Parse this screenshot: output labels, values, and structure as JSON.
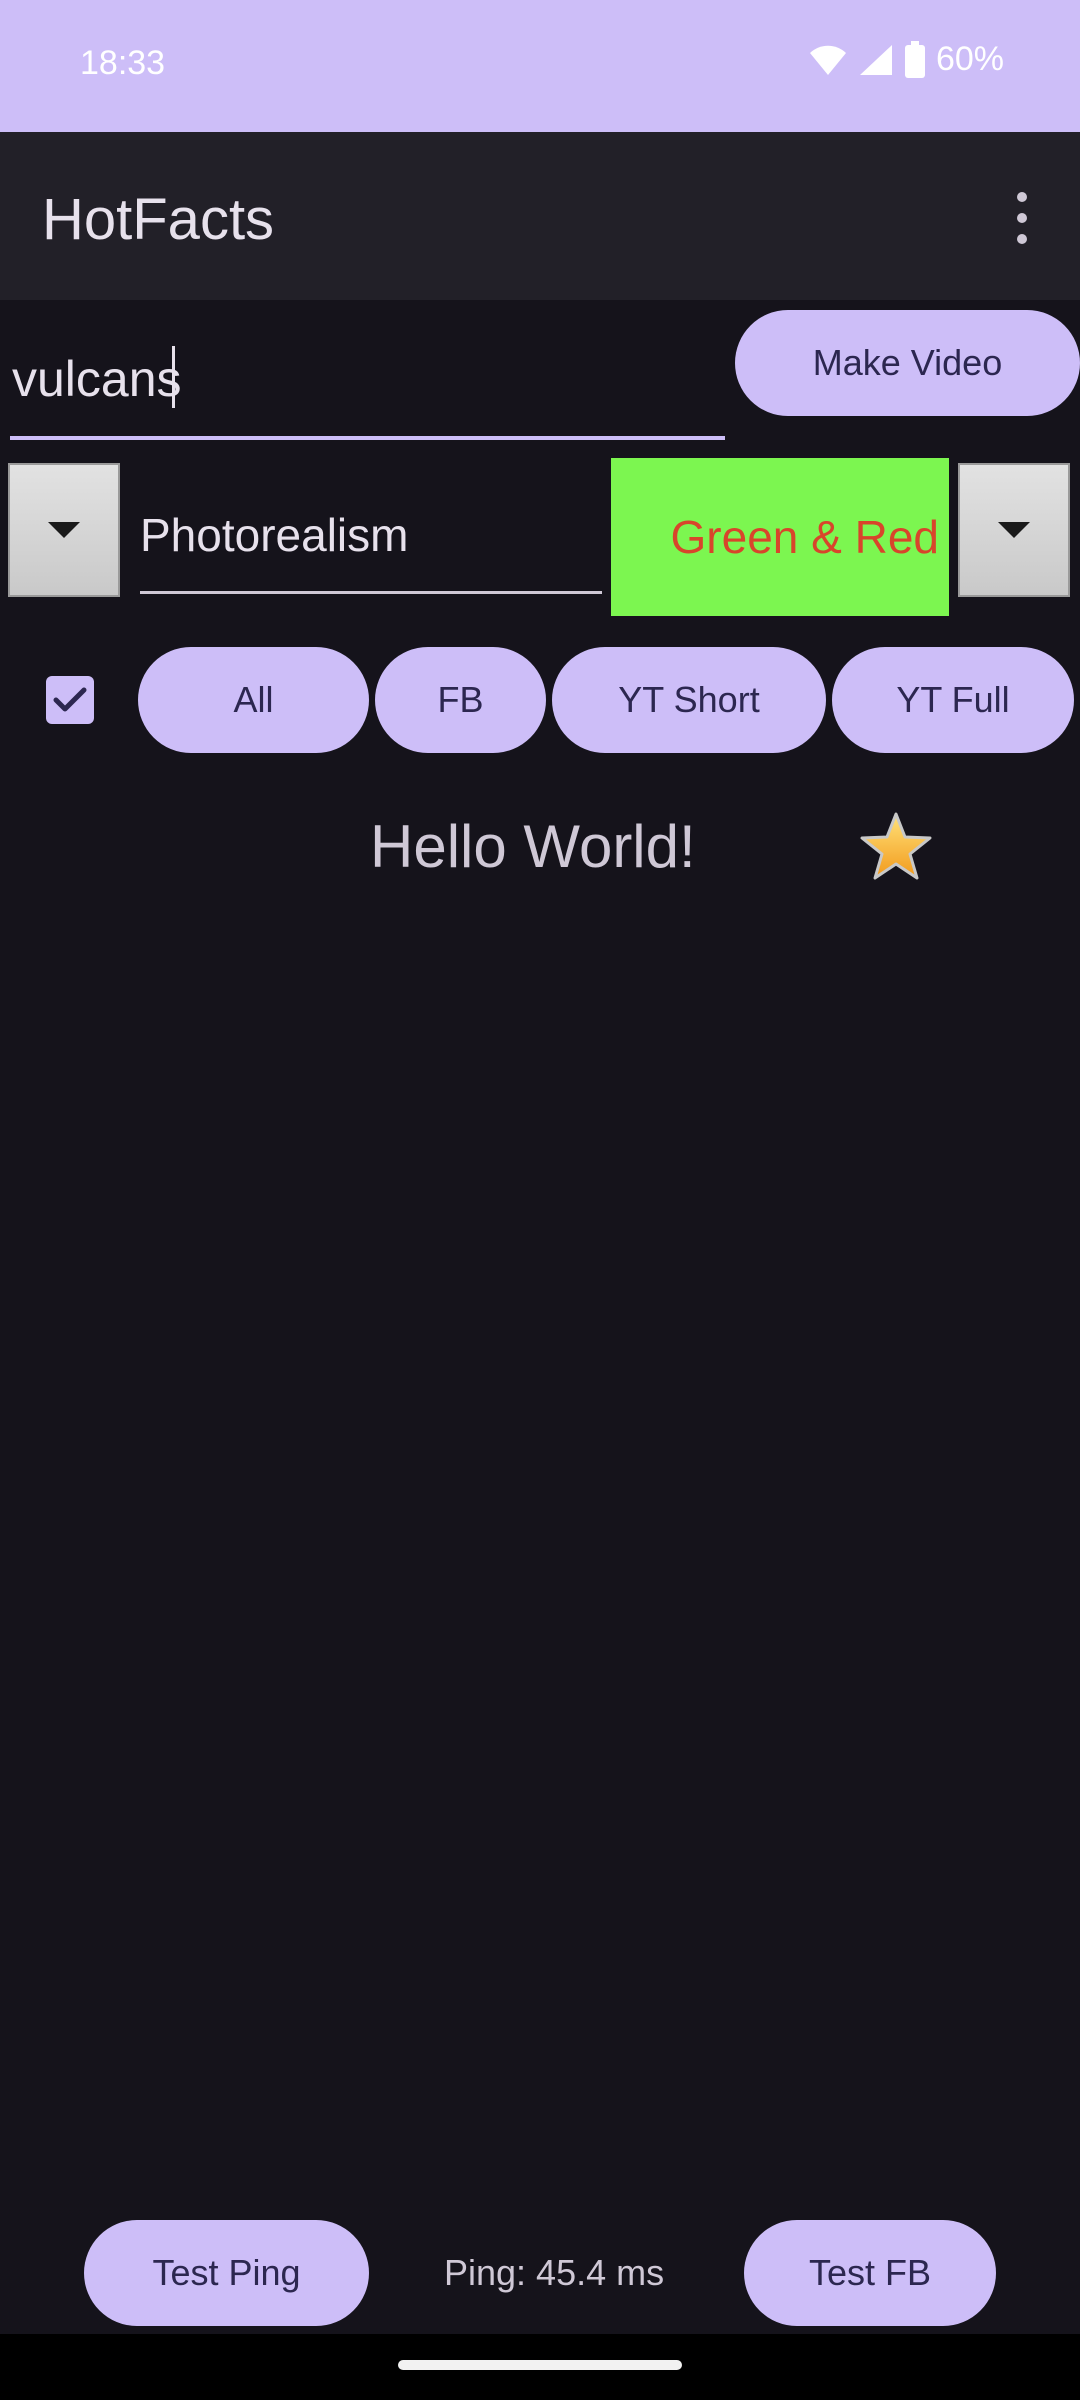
{
  "status": {
    "time": "18:33",
    "battery": "60%"
  },
  "app": {
    "title": "HotFacts"
  },
  "search": {
    "value": "vulcans"
  },
  "buttons": {
    "make_video": "Make Video",
    "all": "All",
    "fb": "FB",
    "yt_short": "YT Short",
    "yt_full": "YT Full",
    "test_ping": "Test Ping",
    "test_fb": "Test FB"
  },
  "style_select": {
    "value": "Photorealism"
  },
  "color_select": {
    "value": "Green & Red",
    "background": "#7cf650",
    "text_color": "#d8452b"
  },
  "checkbox": {
    "checked": true
  },
  "content": {
    "hello": "Hello World!"
  },
  "ping": {
    "text": "Ping: 45.4 ms"
  },
  "colors": {
    "accent": "#cdbef8",
    "background": "#15131b",
    "app_bar": "#222028"
  },
  "icons": [
    "wifi-icon",
    "signal-icon",
    "battery-icon",
    "overflow-menu-icon",
    "dropdown-arrow-icon",
    "check-icon",
    "star-icon"
  ]
}
